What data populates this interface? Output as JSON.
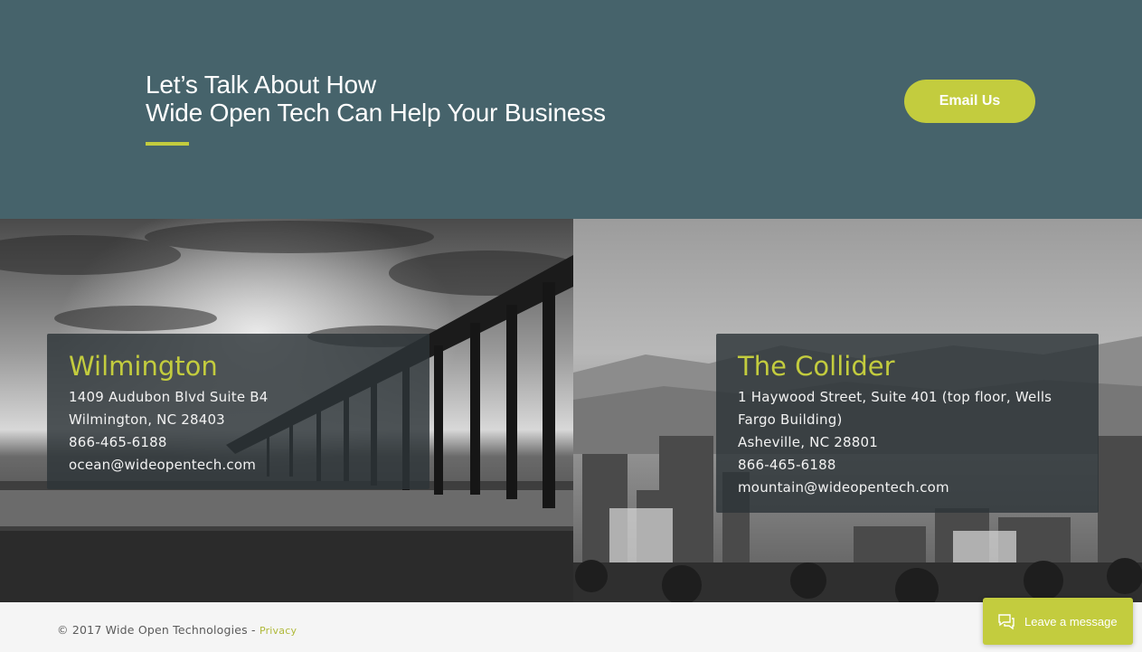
{
  "hero": {
    "title_line1": "Let’s Talk About How",
    "title_line2": "Wide Open Tech Can Help Your Business",
    "cta_label": "Email Us"
  },
  "locations": [
    {
      "title": "Wilmington",
      "lines": [
        "1409 Audubon Blvd Suite B4",
        "Wilmington, NC 28403",
        "866-465-6188",
        "ocean@wideopentech.com"
      ],
      "image": "pier-photo"
    },
    {
      "title": "The Collider",
      "lines": [
        "1 Haywood Street, Suite 401 (top floor, Wells",
        "Fargo Building)",
        "Asheville, NC 28801",
        "866-465-6188",
        "mountain@wideopentech.com"
      ],
      "image": "city-skyline-photo"
    }
  ],
  "footer": {
    "copyright": "© 2017 Wide Open Technologies - ",
    "privacy_label": "Privacy"
  },
  "chat": {
    "label": "Leave a message",
    "icon": "chat-icon"
  },
  "colors": {
    "hero_bg": "#46636b",
    "accent": "#c3cc3e",
    "card_bg": "#2d3438",
    "footer_bg": "#f5f5f5"
  }
}
